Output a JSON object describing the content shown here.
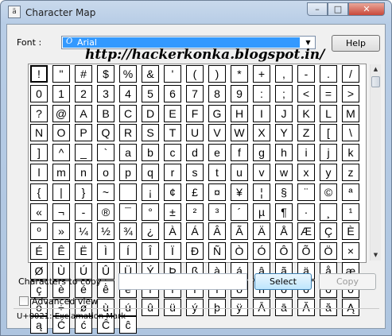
{
  "window": {
    "title": "Character Map",
    "app_icon": "charmap-icon",
    "controls": {
      "minimize": "–",
      "maximize": "□",
      "close": "✕"
    }
  },
  "font_row": {
    "label": "Font :",
    "selected_font": "Arial",
    "font_type_icon": "opentype-font-icon",
    "help_label": "Help"
  },
  "watermark": {
    "text": "http://hackerkonka.blogspot.in/"
  },
  "char_grid": {
    "selected_index": 0,
    "characters": [
      "!",
      "\"",
      "#",
      "$",
      "%",
      "&",
      "'",
      "(",
      ")",
      "*",
      "+",
      ",",
      "-",
      ".",
      "/",
      "0",
      "1",
      "2",
      "3",
      "4",
      "5",
      "6",
      "7",
      "8",
      "9",
      ":",
      ";",
      "<",
      "=",
      ">",
      "?",
      "@",
      "A",
      "B",
      "C",
      "D",
      "E",
      "F",
      "G",
      "H",
      "I",
      "J",
      "K",
      "L",
      "M",
      "N",
      "O",
      "P",
      "Q",
      "R",
      "S",
      "T",
      "U",
      "V",
      "W",
      "X",
      "Y",
      "Z",
      "[",
      "\\",
      "]",
      "^",
      "_",
      "`",
      "a",
      "b",
      "c",
      "d",
      "e",
      "f",
      "g",
      "h",
      "i",
      "j",
      "k",
      "l",
      "m",
      "n",
      "o",
      "p",
      "q",
      "r",
      "s",
      "t",
      "u",
      "v",
      "w",
      "x",
      "y",
      "z",
      "{",
      "|",
      "}",
      "~",
      " ",
      "¡",
      "¢",
      "£",
      "¤",
      "¥",
      "¦",
      "§",
      "¨",
      "©",
      "ª",
      "«",
      "¬",
      "-",
      "®",
      "¯",
      "°",
      "±",
      "²",
      "³",
      "´",
      "µ",
      "¶",
      "·",
      "¸",
      "¹",
      "º",
      "»",
      "¼",
      "½",
      "¾",
      "¿",
      "À",
      "Á",
      "Â",
      "Ã",
      "Ä",
      "Å",
      "Æ",
      "Ç",
      "È",
      "É",
      "Ê",
      "Ë",
      "Ì",
      "Í",
      "Î",
      "Ï",
      "Ð",
      "Ñ",
      "Ò",
      "Ó",
      "Ô",
      "Õ",
      "Ö",
      "×",
      "Ø",
      "Ù",
      "Ú",
      "Û",
      "Ü",
      "Ý",
      "Þ",
      "ß",
      "à",
      "á",
      "â",
      "ã",
      "ä",
      "å",
      "æ",
      "ç",
      "è",
      "é",
      "ê",
      "ë",
      "ì",
      "í",
      "î",
      "ï",
      "ð",
      "ñ",
      "ò",
      "ó",
      "ô",
      "õ",
      "ö",
      "÷",
      "ø",
      "ù",
      "ú",
      "û",
      "ü",
      "ý",
      "þ",
      "ÿ",
      "Ā",
      "ā",
      "Ă",
      "ă",
      "Ą",
      "ą",
      "Ć",
      "ć",
      "Ĉ",
      "ĉ"
    ]
  },
  "scrollbar": {
    "up_icon": "scroll-up-arrow-icon",
    "down_icon": "scroll-down-arrow-icon"
  },
  "copy_row": {
    "label": "Characters to copy :",
    "value": "",
    "select_label": "Select",
    "copy_label": "Copy"
  },
  "advanced": {
    "label": "Advanced view",
    "checked": false
  },
  "status": {
    "text": "U+0021: Exclamation Mark"
  },
  "colors": {
    "selection": "#3399ff",
    "title_gradient_top": "#c9d9ec",
    "close_button": "#c9483a"
  }
}
